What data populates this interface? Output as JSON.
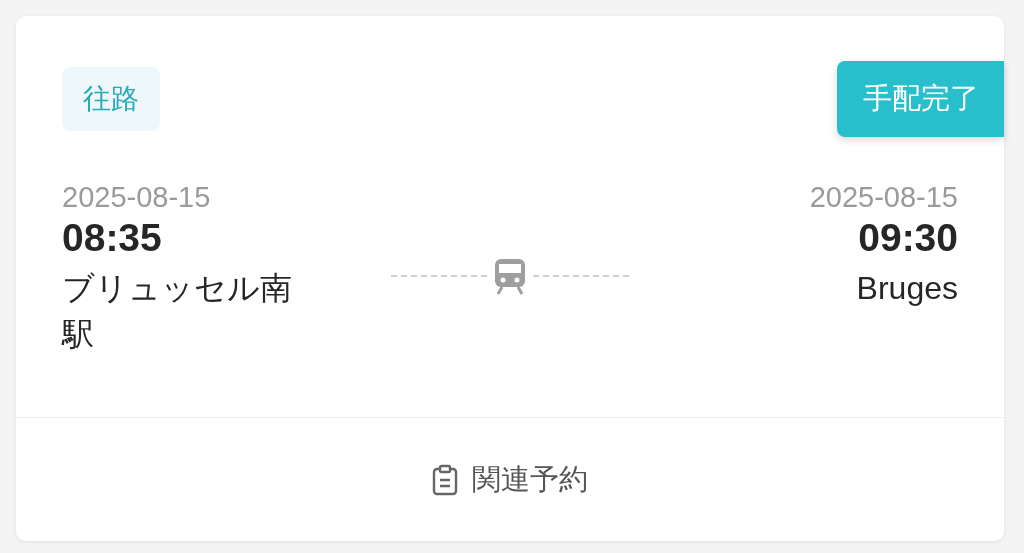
{
  "direction_tag": "往路",
  "status_badge": "手配完了",
  "departure": {
    "date": "2025-08-15",
    "time": "08:35",
    "station": "ブリュッセル南駅"
  },
  "arrival": {
    "date": "2025-08-15",
    "time": "09:30",
    "station": "Bruges"
  },
  "footer_link": "関連予約"
}
